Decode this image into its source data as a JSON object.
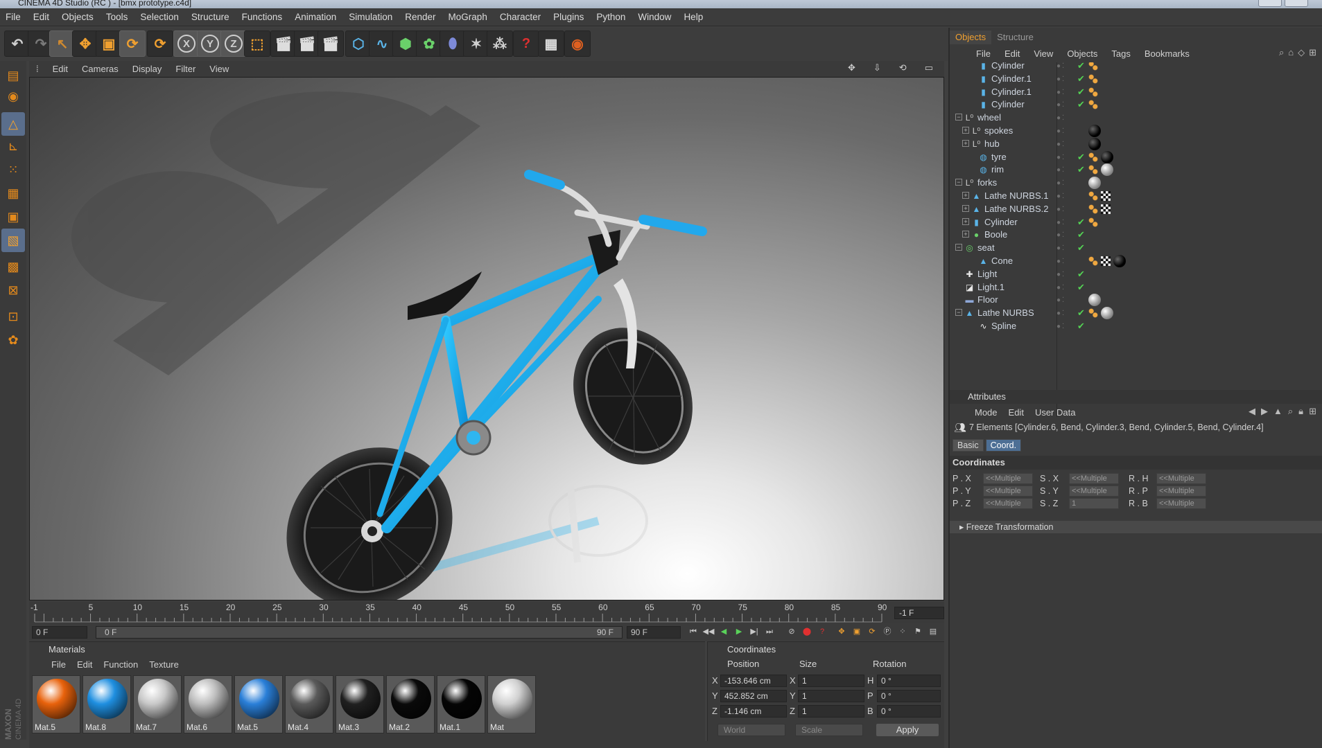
{
  "window": {
    "title": "CINEMA 4D Studio (RC ) - [bmx prototype.c4d]"
  },
  "menubar": [
    "File",
    "Edit",
    "Objects",
    "Tools",
    "Selection",
    "Structure",
    "Functions",
    "Animation",
    "Simulation",
    "Render",
    "MoGraph",
    "Character",
    "Plugins",
    "Python",
    "Window",
    "Help"
  ],
  "toolbar": {
    "icons": [
      "undo-icon",
      "redo-icon",
      "live-select-icon",
      "move-icon",
      "scale-icon",
      "rotate-icon",
      "recent-tool-icon",
      "x-axis-lock-icon",
      "y-axis-lock-icon",
      "z-axis-lock-icon",
      "world-coord-icon",
      "render-view-icon",
      "render-picture-viewer-icon",
      "render-settings-icon",
      "cube-icon",
      "spline-pen-icon",
      "subdivision-icon",
      "array-icon",
      "deformer-bend-icon",
      "scene-camera-icon",
      "particles-icon",
      "help-icon",
      "render-queue-icon",
      "web-icon"
    ],
    "axis_labels": [
      "X",
      "Y",
      "Z"
    ]
  },
  "left_tools": [
    "layout-icon",
    "model-mode-icon",
    "object-mode-icon",
    "axis-mode-icon",
    "points-mode-icon",
    "edges-mode-icon",
    "polygons-mode-icon",
    "uv-mode-icon",
    "texture-mode-icon",
    "snap-icon",
    "workplane-icon",
    "soft-select-icon"
  ],
  "viewport": {
    "menu": [
      "Edit",
      "Cameras",
      "Display",
      "Filter",
      "View"
    ]
  },
  "timeline": {
    "ticks": [
      "-1",
      "5",
      "10",
      "15",
      "20",
      "25",
      "30",
      "35",
      "40",
      "45",
      "50",
      "55",
      "60",
      "65",
      "70",
      "75",
      "80",
      "85",
      "90"
    ],
    "current_frame": "-1 F",
    "start": "0 F",
    "range_start": "0 F",
    "range_end": "90 F",
    "end": "90 F"
  },
  "materials": {
    "title": "Materials",
    "menu": [
      "File",
      "Edit",
      "Function",
      "Texture"
    ],
    "items": [
      {
        "label": "Mat.5",
        "color": "#e8620c"
      },
      {
        "label": "Mat.8",
        "color": "#1f8fe0"
      },
      {
        "label": "Mat.7",
        "color": "#c8c8c8"
      },
      {
        "label": "Mat.6",
        "color": "#bdbdbd"
      },
      {
        "label": "Mat.5",
        "color": "#2a7fd8"
      },
      {
        "label": "Mat.4",
        "color": "#5a5a5a"
      },
      {
        "label": "Mat.3",
        "color": "#202020"
      },
      {
        "label": "Mat.2",
        "color": "#0a0a0a"
      },
      {
        "label": "Mat.1",
        "color": "#050505"
      },
      {
        "label": "Mat",
        "color": "#d0d0d0"
      }
    ]
  },
  "coords": {
    "title": "Coordinates",
    "headers": [
      "Position",
      "Size",
      "Rotation"
    ],
    "rows": [
      {
        "axis": "X",
        "pos": "-153.646 cm",
        "size_axis": "X",
        "size": "1",
        "rot_axis": "H",
        "rot": "0 °"
      },
      {
        "axis": "Y",
        "pos": "452.852 cm",
        "size_axis": "Y",
        "size": "1",
        "rot_axis": "P",
        "rot": "0 °"
      },
      {
        "axis": "Z",
        "pos": "-1.146 cm",
        "size_axis": "Z",
        "size": "1",
        "rot_axis": "B",
        "rot": "0 °"
      }
    ],
    "mode": "World",
    "size_mode": "Scale",
    "apply": "Apply"
  },
  "objects_panel": {
    "tabs": [
      "Objects",
      "Structure"
    ],
    "menu": [
      "File",
      "Edit",
      "View",
      "Objects",
      "Tags",
      "Bookmarks"
    ],
    "rows": [
      {
        "name": "Cylinder",
        "indent": 2,
        "icon": "cylinder-icon",
        "exp": "",
        "tags": [
          "phong"
        ],
        "check": true
      },
      {
        "name": "Cylinder.1",
        "indent": 2,
        "icon": "cylinder-icon",
        "exp": "",
        "tags": [
          "phong"
        ],
        "check": true
      },
      {
        "name": "Cylinder.1",
        "indent": 2,
        "icon": "cylinder-icon",
        "exp": "",
        "tags": [
          "phong"
        ],
        "check": true
      },
      {
        "name": "Cylinder",
        "indent": 2,
        "icon": "cylinder-icon",
        "exp": "",
        "tags": [
          "phong"
        ],
        "check": true
      },
      {
        "name": "wheel",
        "indent": 0,
        "icon": "null-icon",
        "exp": "−",
        "tags": [],
        "check": false
      },
      {
        "name": "spokes",
        "indent": 1,
        "icon": "null-icon",
        "exp": "+",
        "tags": [
          "black"
        ],
        "check": false
      },
      {
        "name": "hub",
        "indent": 1,
        "icon": "null-icon",
        "exp": "+",
        "tags": [
          "black"
        ],
        "check": false
      },
      {
        "name": "tyre",
        "indent": 2,
        "icon": "tube-icon",
        "exp": "",
        "tags": [
          "phong",
          "black"
        ],
        "check": true
      },
      {
        "name": "rim",
        "indent": 2,
        "icon": "tube-icon",
        "exp": "",
        "tags": [
          "phong",
          "grey"
        ],
        "check": true
      },
      {
        "name": "forks",
        "indent": 0,
        "icon": "null-icon",
        "exp": "−",
        "tags": [
          "grey"
        ],
        "check": false
      },
      {
        "name": "Lathe NURBS.1",
        "indent": 1,
        "icon": "lathe-icon",
        "exp": "+",
        "tags": [
          "phong",
          "checker"
        ],
        "check": false
      },
      {
        "name": "Lathe NURBS.2",
        "indent": 1,
        "icon": "lathe-icon",
        "exp": "+",
        "tags": [
          "phong",
          "checker"
        ],
        "check": false
      },
      {
        "name": "Cylinder",
        "indent": 1,
        "icon": "cylinder-icon",
        "exp": "+",
        "tags": [
          "phong"
        ],
        "check": true
      },
      {
        "name": "Boole",
        "indent": 1,
        "icon": "boole-icon",
        "exp": "+",
        "tags": [],
        "check": true
      },
      {
        "name": "seat",
        "indent": 0,
        "icon": "sweep-icon",
        "exp": "−",
        "tags": [],
        "check": true
      },
      {
        "name": "Cone",
        "indent": 2,
        "icon": "cone-icon",
        "exp": "",
        "tags": [
          "phong",
          "checker",
          "black"
        ],
        "check": false
      },
      {
        "name": "Light",
        "indent": 0,
        "icon": "light-icon",
        "exp": "",
        "tags": [],
        "check": true
      },
      {
        "name": "Light.1",
        "indent": 0,
        "icon": "area-light-icon",
        "exp": "",
        "tags": [],
        "check": true
      },
      {
        "name": "Floor",
        "indent": 0,
        "icon": "floor-icon",
        "exp": "",
        "tags": [
          "grey"
        ],
        "check": false
      },
      {
        "name": "Lathe NURBS",
        "indent": 0,
        "icon": "lathe-icon",
        "exp": "−",
        "tags": [
          "phong",
          "grey"
        ],
        "check": true
      },
      {
        "name": "Spline",
        "indent": 2,
        "icon": "spline-icon",
        "exp": "",
        "tags": [],
        "check": true
      }
    ]
  },
  "attributes": {
    "title": "Attributes",
    "menu": [
      "Mode",
      "Edit",
      "User Data"
    ],
    "elements": "7 Elements [Cylinder.6, Bend, Cylinder.3, Bend, Cylinder.5, Bend, Cylinder.4]",
    "tabs": [
      "Basic",
      "Coord."
    ],
    "section": "Coordinates",
    "rows": [
      {
        "p": "P . X",
        "pv": "<<Multiple",
        "s": "S . X",
        "sv": "<<Multiple",
        "r": "R . H",
        "rv": "<<Multiple"
      },
      {
        "p": "P . Y",
        "pv": "<<Multiple",
        "s": "S . Y",
        "sv": "<<Multiple",
        "r": "R . P",
        "rv": "<<Multiple"
      },
      {
        "p": "P . Z",
        "pv": "<<Multiple",
        "s": "S . Z",
        "sv": "1",
        "r": "R . B",
        "rv": "<<Multiple"
      }
    ],
    "freeze": "Freeze Transformation"
  },
  "brand": "MAXON CINEMA 4D"
}
